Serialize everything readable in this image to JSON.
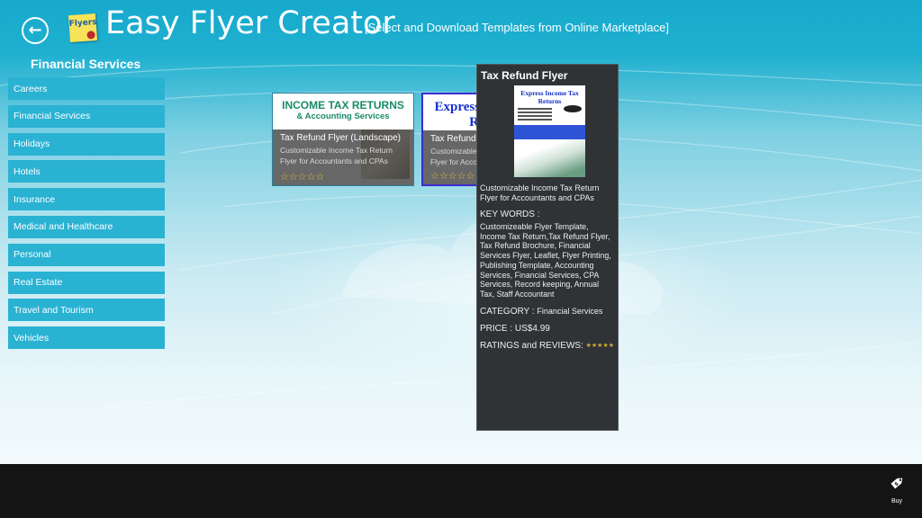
{
  "header": {
    "back_icon": "arrow-left-circle-icon",
    "logo_text": "Flyers",
    "app_title": "Easy Flyer Creator",
    "subtitle": "[Select and Download Templates from Online Marketplace]"
  },
  "section_title": "Financial Services",
  "categories": [
    {
      "label": "Careers"
    },
    {
      "label": "Financial Services"
    },
    {
      "label": "Holidays"
    },
    {
      "label": "Hotels"
    },
    {
      "label": "Insurance"
    },
    {
      "label": "Medical and Healthcare"
    },
    {
      "label": "Personal"
    },
    {
      "label": "Real Estate"
    },
    {
      "label": "Travel and Tourism"
    },
    {
      "label": "Vehicles"
    }
  ],
  "templates": [
    {
      "thumb_heading": "INCOME TAX RETURNS",
      "thumb_subheading": "& Accounting Services",
      "title": "Tax Refund Flyer (Landscape)",
      "description": "Customizable Income Tax Return Flyer for Accountants and CPAs",
      "stars": "☆☆☆☆☆",
      "rating": 5
    },
    {
      "thumb_heading": "Express Income Tax Returns",
      "title": "Tax Refund Flyer",
      "description": "Customizable Income Tax Return Flyer for Accountants and CPAs",
      "stars": "☆☆☆☆☆",
      "rating": 5
    }
  ],
  "detail": {
    "title": "Tax Refund Flyer",
    "thumb_heading": "Express Income Tax Returns",
    "description": "Customizable Income Tax Return Flyer for Accountants and CPAs",
    "keywords_label": "KEY WORDS :",
    "keywords": "Customizeable Flyer Template, Income Tax Return,Tax Refund Flyer, Tax Refund Brochure, Financial Services Flyer, Leaflet, Flyer Printing, Publishing Template, Accounting Services, Financial Services, CPA Services, Record keeping, Annual Tax, Staff Accountant",
    "category_label": "CATEGORY :",
    "category_value": "Financial Services",
    "price_label": "PRICE :",
    "price_value": "US$4.99",
    "ratings_label": "RATINGS and REVIEWS:",
    "ratings_stars": "★★★★★",
    "rating": 5
  },
  "appbar": {
    "buy_icon": "price-tag-icon",
    "buy_label": "Buy"
  },
  "colors": {
    "header_bg": "#17a9cc",
    "category_tile": "#2ab2d3",
    "flyout_bg": "#2f3336",
    "appbar_bg": "#141414",
    "star": "#e5b93a"
  }
}
